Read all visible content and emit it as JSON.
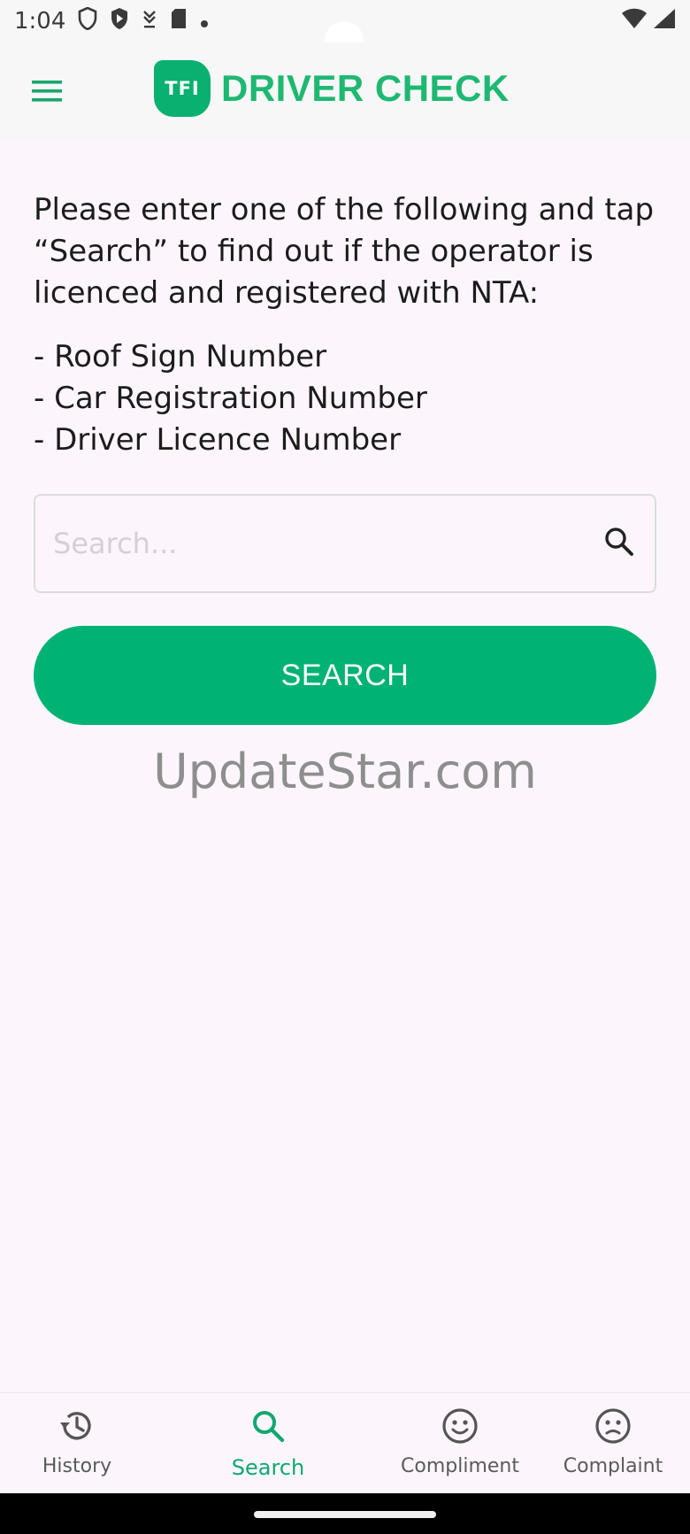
{
  "status_bar": {
    "time": "1:04"
  },
  "app_bar": {
    "logo_badge": "TFI",
    "title": "DRIVER CHECK"
  },
  "intro": {
    "text": "Please enter one of the following and tap “Search” to find out if the operator is licenced and registered with NTA:"
  },
  "options": [
    "- Roof Sign Number",
    "- Car Registration Number",
    "- Driver Licence Number"
  ],
  "search": {
    "placeholder": "Search...",
    "value": "",
    "button_label": "SEARCH"
  },
  "watermark": "UpdateStar.com",
  "bottom_nav": {
    "items": [
      {
        "label": "History"
      },
      {
        "label": "Search"
      },
      {
        "label": "Compliment"
      },
      {
        "label": "Complaint"
      }
    ],
    "active": "Search"
  },
  "colors": {
    "accent": "#00b374",
    "background": "#fcf6fc",
    "app_bar": "#f7f7f7"
  },
  "icons": {
    "menu": "hamburger-icon",
    "search": "search-icon",
    "history": "history-icon",
    "compliment": "smile-icon",
    "complaint": "frown-icon"
  }
}
